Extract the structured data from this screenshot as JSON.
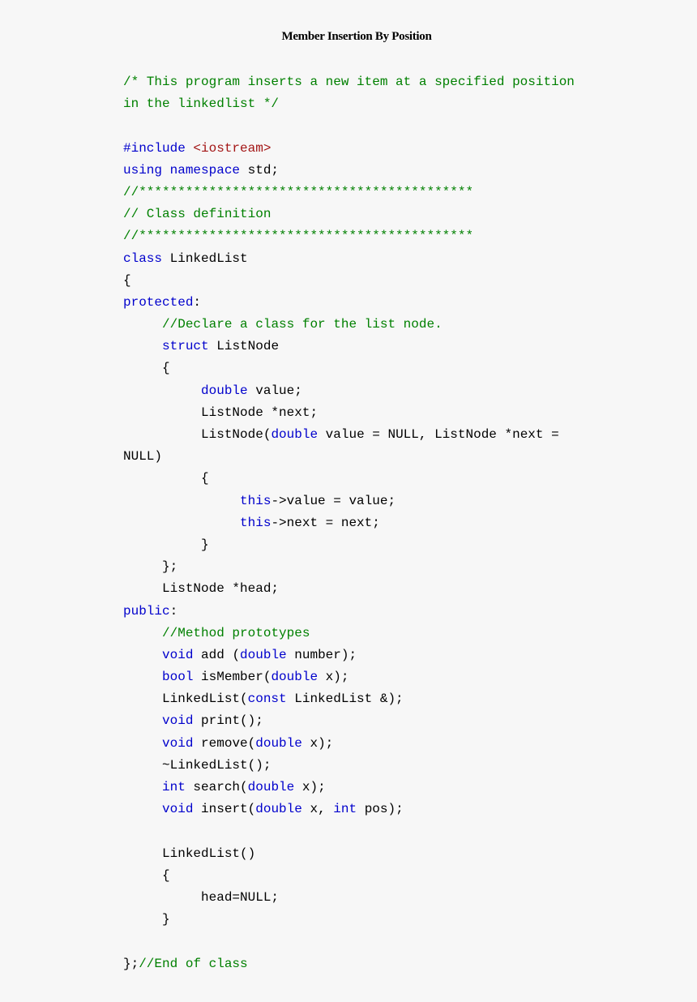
{
  "document": {
    "title": "Member Insertion By Position",
    "colors": {
      "keyword": "#0000cc",
      "comment": "#008000",
      "string": "#a31515",
      "text": "#000000",
      "background": "#f7f7f7"
    },
    "code_lines": [
      [
        [
          "cm",
          "/* This program inserts a new item at a specified position"
        ]
      ],
      [
        [
          "cm",
          "in the linkedlist */"
        ]
      ],
      [],
      [
        [
          "kw",
          "#include "
        ],
        [
          "st",
          "<iostream>"
        ]
      ],
      [
        [
          "kw",
          "using namespace "
        ],
        [
          "tx",
          "std;"
        ]
      ],
      [
        [
          "cm",
          "//*******************************************"
        ]
      ],
      [
        [
          "cm",
          "// Class definition"
        ]
      ],
      [
        [
          "cm",
          "//*******************************************"
        ]
      ],
      [
        [
          "kw",
          "class "
        ],
        [
          "tx",
          "LinkedList"
        ]
      ],
      [
        [
          "tx",
          "{"
        ]
      ],
      [
        [
          "kw",
          "protected"
        ],
        [
          "tx",
          ":"
        ]
      ],
      [
        [
          "tx",
          "     "
        ],
        [
          "cm",
          "//Declare a class for the list node."
        ]
      ],
      [
        [
          "tx",
          "     "
        ],
        [
          "kw",
          "struct "
        ],
        [
          "tx",
          "ListNode"
        ]
      ],
      [
        [
          "tx",
          "     {"
        ]
      ],
      [
        [
          "tx",
          "          "
        ],
        [
          "kw",
          "double "
        ],
        [
          "tx",
          "value;"
        ]
      ],
      [
        [
          "tx",
          "          ListNode *next;"
        ]
      ],
      [
        [
          "tx",
          "          ListNode("
        ],
        [
          "kw",
          "double "
        ],
        [
          "tx",
          "value = NULL, ListNode *next ="
        ]
      ],
      [
        [
          "tx",
          "NULL)"
        ]
      ],
      [
        [
          "tx",
          "          {"
        ]
      ],
      [
        [
          "tx",
          "               "
        ],
        [
          "kw",
          "this"
        ],
        [
          "tx",
          "->value = value;"
        ]
      ],
      [
        [
          "tx",
          "               "
        ],
        [
          "kw",
          "this"
        ],
        [
          "tx",
          "->next = next;"
        ]
      ],
      [
        [
          "tx",
          "          }"
        ]
      ],
      [
        [
          "tx",
          "     };"
        ]
      ],
      [
        [
          "tx",
          "     ListNode *head;"
        ]
      ],
      [
        [
          "kw",
          "public"
        ],
        [
          "tx",
          ":"
        ]
      ],
      [
        [
          "tx",
          "     "
        ],
        [
          "cm",
          "//Method prototypes"
        ]
      ],
      [
        [
          "tx",
          "     "
        ],
        [
          "kw",
          "void "
        ],
        [
          "tx",
          "add ("
        ],
        [
          "kw",
          "double "
        ],
        [
          "tx",
          "number);"
        ]
      ],
      [
        [
          "tx",
          "     "
        ],
        [
          "kw",
          "bool "
        ],
        [
          "tx",
          "isMember("
        ],
        [
          "kw",
          "double "
        ],
        [
          "tx",
          "x);"
        ]
      ],
      [
        [
          "tx",
          "     LinkedList("
        ],
        [
          "kw",
          "const "
        ],
        [
          "tx",
          "LinkedList &);"
        ]
      ],
      [
        [
          "tx",
          "     "
        ],
        [
          "kw",
          "void "
        ],
        [
          "tx",
          "print();"
        ]
      ],
      [
        [
          "tx",
          "     "
        ],
        [
          "kw",
          "void "
        ],
        [
          "tx",
          "remove("
        ],
        [
          "kw",
          "double "
        ],
        [
          "tx",
          "x);"
        ]
      ],
      [
        [
          "tx",
          "     ~LinkedList();"
        ]
      ],
      [
        [
          "tx",
          "     "
        ],
        [
          "kw",
          "int "
        ],
        [
          "tx",
          "search("
        ],
        [
          "kw",
          "double "
        ],
        [
          "tx",
          "x);"
        ]
      ],
      [
        [
          "tx",
          "     "
        ],
        [
          "kw",
          "void "
        ],
        [
          "tx",
          "insert("
        ],
        [
          "kw",
          "double "
        ],
        [
          "tx",
          "x, "
        ],
        [
          "kw",
          "int "
        ],
        [
          "tx",
          "pos);"
        ]
      ],
      [],
      [
        [
          "tx",
          "     LinkedList()"
        ]
      ],
      [
        [
          "tx",
          "     {"
        ]
      ],
      [
        [
          "tx",
          "          head=NULL;"
        ]
      ],
      [
        [
          "tx",
          "     }"
        ]
      ],
      [],
      [
        [
          "tx",
          "};"
        ],
        [
          "cm",
          "//End of class"
        ]
      ]
    ]
  }
}
